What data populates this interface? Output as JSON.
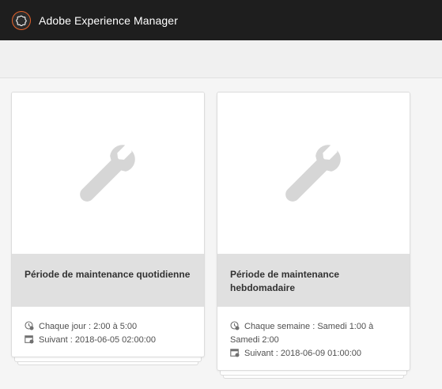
{
  "header": {
    "app_title": "Adobe Experience Manager",
    "logo_icon": "adobe-experience-manager-logo"
  },
  "cards": [
    {
      "title": "Période de maintenance quotidienne",
      "schedule": "Chaque jour : 2:00 à 5:00",
      "next": "Suivant : 2018-06-05 02:00:00",
      "thumbnail_icon": "wrench-icon"
    },
    {
      "title": "Période de maintenance hebdomadaire",
      "schedule": "Chaque semaine : Samedi 1:00 à Samedi 2:00",
      "next": "Suivant : 2018-06-09 01:00:00",
      "thumbnail_icon": "wrench-icon"
    }
  ],
  "colors": {
    "topbar": "#1e1e1e",
    "logo_accent": "#e6622a",
    "title_band": "#e0e0e0",
    "icon_gray": "#d6d6d6"
  }
}
